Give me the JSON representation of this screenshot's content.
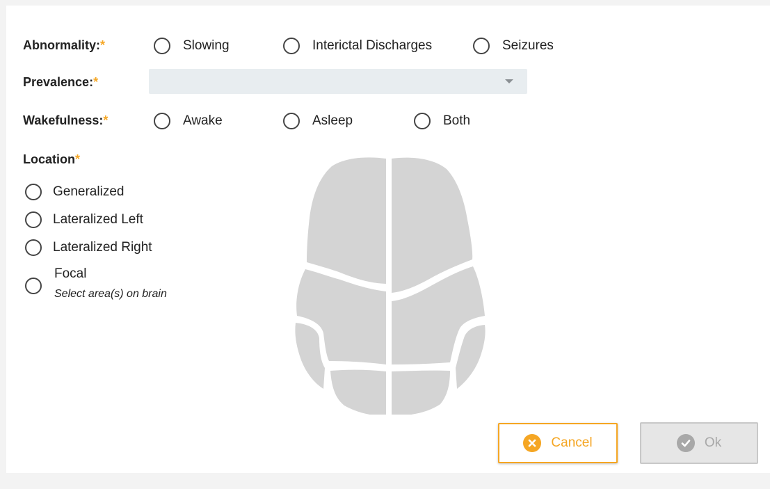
{
  "form": {
    "abnormality": {
      "label": "Abnormality:",
      "required_mark": "*",
      "options": [
        "Slowing",
        "Interictal Discharges",
        "Seizures"
      ]
    },
    "prevalence": {
      "label": "Prevalence:",
      "required_mark": "*",
      "value": ""
    },
    "wakefulness": {
      "label": "Wakefulness:",
      "required_mark": "*",
      "options": [
        "Awake",
        "Asleep",
        "Both"
      ]
    },
    "location": {
      "label": "Location",
      "required_mark": "*",
      "options": [
        "Generalized",
        "Lateralized Left",
        "Lateralized Right",
        "Focal"
      ],
      "focal_hint": "Select area(s) on brain"
    }
  },
  "actions": {
    "cancel_label": "Cancel",
    "ok_label": "Ok",
    "ok_enabled": false
  },
  "colors": {
    "required": "#f5a623",
    "cancel_accent": "#f5a623",
    "disabled": "#a8a8a8",
    "brain_region": "#d4d4d4",
    "dropdown_bg": "#e8edf0"
  },
  "icons": {
    "cancel": "close-circle-icon",
    "ok": "check-circle-icon",
    "dropdown": "caret-down-icon",
    "brain": "brain-top-view"
  }
}
